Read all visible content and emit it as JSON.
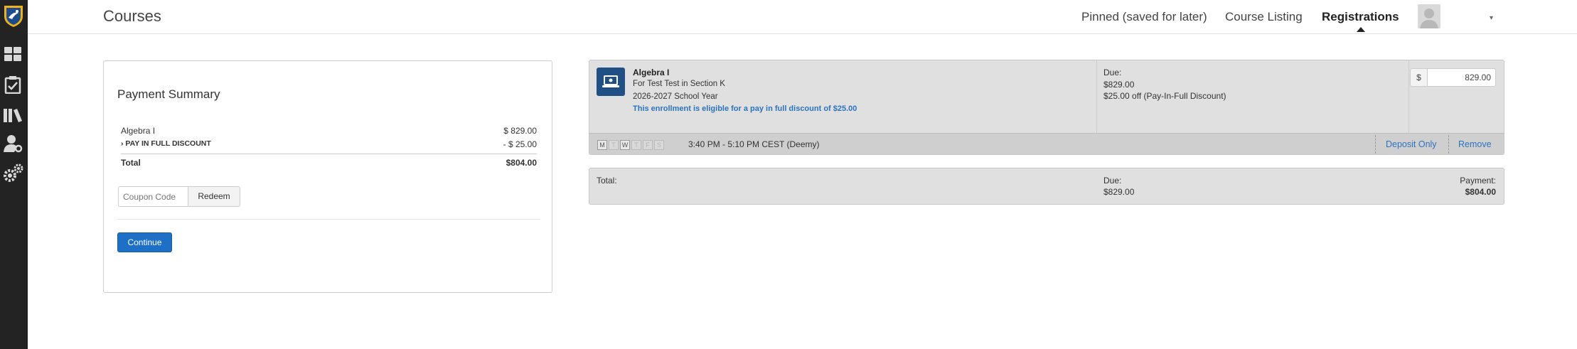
{
  "header": {
    "title": "Courses",
    "nav": {
      "pinned": "Pinned (saved for later)",
      "course_listing": "Course Listing",
      "registrations": "Registrations"
    }
  },
  "sidebar": {
    "icons": [
      "dashboard-icon",
      "checklist-icon",
      "library-icon",
      "user-settings-icon",
      "gears-icon"
    ]
  },
  "payment_summary": {
    "title": "Payment Summary",
    "course_name": "Algebra I",
    "course_amount": "$ 829.00",
    "discount_label": "PAY IN FULL DISCOUNT",
    "discount_amount": "- $ 25.00",
    "total_label": "Total",
    "total_amount": "$804.00",
    "coupon_placeholder": "Coupon Code",
    "redeem_label": "Redeem",
    "continue_label": "Continue"
  },
  "enrollment": {
    "course_name": "Algebra I",
    "for_line": "For Test Test in Section K",
    "school_year": "2026-2027 School Year",
    "eligible_note": "This enrollment is eligible for a pay in full discount of $25.00",
    "due_label": "Due:",
    "due_amount": "$829.00",
    "discount_note": "$25.00 off (Pay-In-Full Discount)",
    "currency_symbol": "$",
    "payment_value": "829.00",
    "days": [
      "M",
      "T",
      "W",
      "T",
      "F",
      "S"
    ],
    "schedule": "3:40 PM - 5:10 PM CEST (Deemy)",
    "deposit_only_label": "Deposit Only",
    "remove_label": "Remove"
  },
  "totals": {
    "total_label": "Total:",
    "due_label": "Due:",
    "due_amount": "$829.00",
    "payment_label": "Payment:",
    "payment_amount": "$804.00"
  },
  "colors": {
    "accent": "#1e6fc6",
    "link": "#2c73c0",
    "sidebar": "#232323",
    "course_icon": "#1f4f85"
  }
}
